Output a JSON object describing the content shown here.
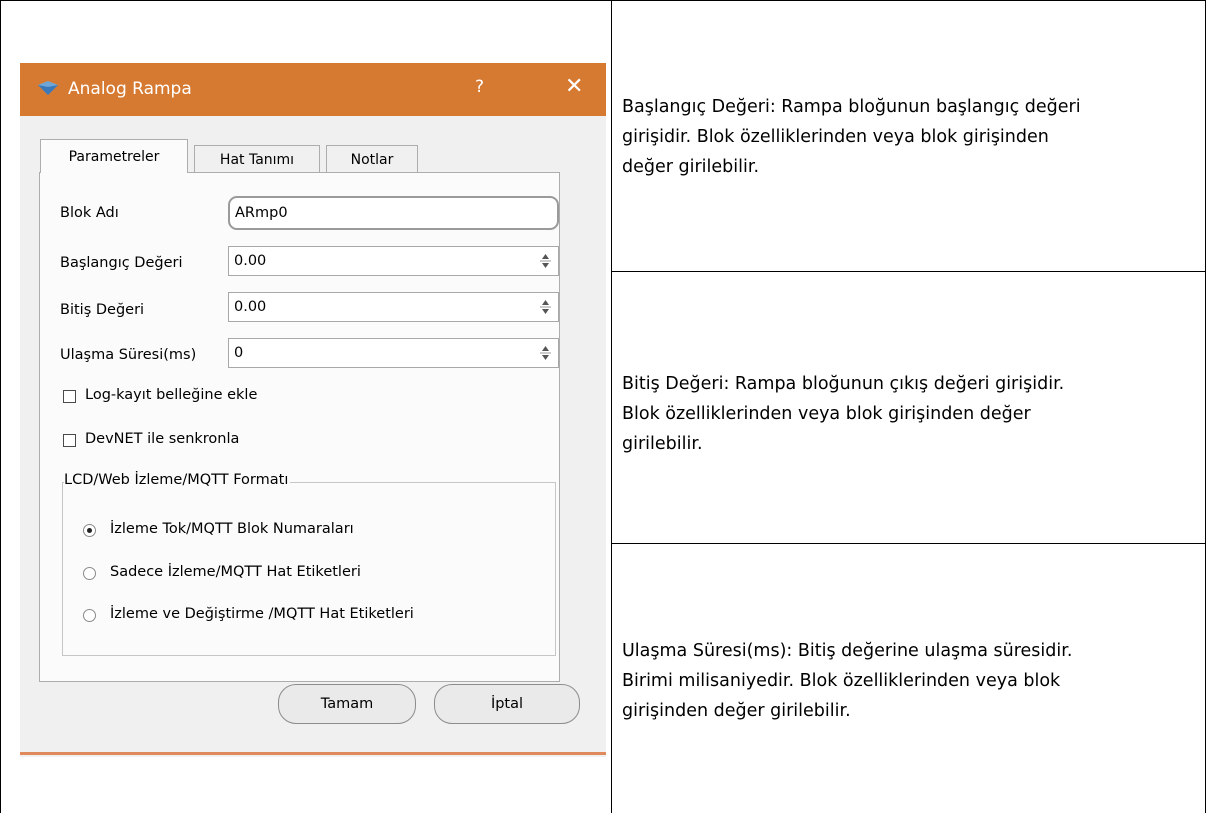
{
  "dialog": {
    "title": "Analog Rampa",
    "help_label": "?",
    "close_label": "✕",
    "tabs": [
      {
        "label": "Parametreler"
      },
      {
        "label": "Hat Tanımı"
      },
      {
        "label": "Notlar"
      }
    ],
    "fields": {
      "blok_adi": {
        "label": "Blok Adı",
        "value": "ARmp0"
      },
      "baslangic": {
        "label": "Başlangıç Değeri",
        "value": "0.00"
      },
      "bitis": {
        "label": "Bitiş Değeri",
        "value": "0.00"
      },
      "ulasma": {
        "label": "Ulaşma Süresi(ms)",
        "value": "0"
      }
    },
    "checkboxes": [
      {
        "label": "Log-kayıt belleğine ekle",
        "checked": false
      },
      {
        "label": "DevNET ile senkronla",
        "checked": false
      }
    ],
    "group": {
      "title": "LCD/Web İzleme/MQTT Formatı",
      "options": [
        {
          "label": "İzleme Tok/MQTT Blok Numaraları",
          "selected": true
        },
        {
          "label": "Sadece İzleme/MQTT Hat Etiketleri",
          "selected": false
        },
        {
          "label": "İzleme ve Değiştirme /MQTT Hat Etiketleri",
          "selected": false
        }
      ]
    },
    "buttons": {
      "ok": "Tamam",
      "cancel": "İptal"
    },
    "colors": {
      "titlebar": "#d67a32"
    }
  },
  "descriptions": [
    {
      "lines": [
        "Başlangıç Değeri:  Rampa bloğunun başlangıç değeri",
        "girişidir. Blok özelliklerinden veya blok girişinden",
        "değer girilebilir."
      ]
    },
    {
      "lines": [
        "Bitiş Değeri:  Rampa bloğunun çıkış değeri girişidir.",
        "Blok özelliklerinden veya blok girişinden değer",
        "girilebilir."
      ]
    },
    {
      "lines": [
        "Ulaşma Süresi(ms):  Bitiş değerine ulaşma süresidir.",
        "Birimi milisaniyedir. Blok özelliklerinden veya blok",
        "girişinden değer girilebilir."
      ]
    }
  ]
}
